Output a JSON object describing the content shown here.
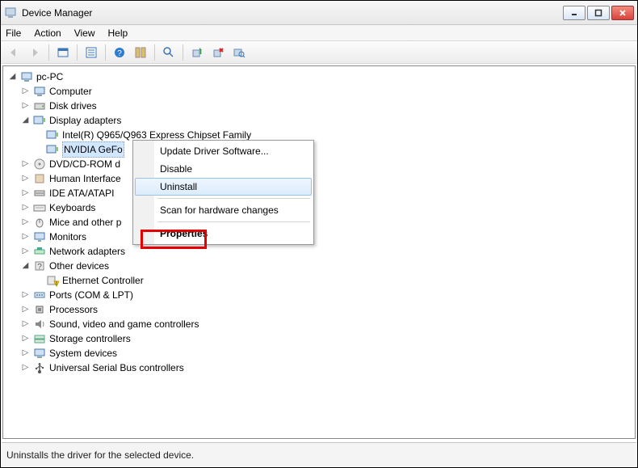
{
  "title": "Device Manager",
  "menu": {
    "file": "File",
    "action": "Action",
    "view": "View",
    "help": "Help"
  },
  "toolbar": {
    "back": "Back",
    "forward": "Forward",
    "show_hidden": "Show hidden",
    "properties": "Properties",
    "help": "Help",
    "options": "Options",
    "find": "Find",
    "update": "Update driver",
    "uninstall": "Uninstall",
    "scan": "Scan for hardware changes"
  },
  "tree": {
    "root": "pc-PC",
    "nodes": [
      {
        "label": "Computer",
        "icon": "computer"
      },
      {
        "label": "Disk drives",
        "icon": "disk"
      },
      {
        "label": "Display adapters",
        "icon": "display",
        "expanded": true,
        "children": [
          {
            "label": "Intel(R)  Q965/Q963 Express Chipset Family",
            "icon": "display"
          },
          {
            "label": "NVIDIA GeFo",
            "icon": "display",
            "selected": true
          }
        ]
      },
      {
        "label": "DVD/CD-ROM drives",
        "icon": "dvd",
        "truncated": "DVD/CD-ROM d"
      },
      {
        "label": "Human Interface Devices",
        "icon": "hid",
        "truncated": "Human Interface"
      },
      {
        "label": "IDE ATA/ATAPI controllers",
        "icon": "ide",
        "truncated": "IDE ATA/ATAPI"
      },
      {
        "label": "Keyboards",
        "icon": "keyboard"
      },
      {
        "label": "Mice and other pointing devices",
        "icon": "mouse",
        "truncated": "Mice and other p"
      },
      {
        "label": "Monitors",
        "icon": "monitor"
      },
      {
        "label": "Network adapters",
        "icon": "network"
      },
      {
        "label": "Other devices",
        "icon": "other",
        "expanded": true,
        "children": [
          {
            "label": "Ethernet Controller",
            "icon": "warning"
          }
        ]
      },
      {
        "label": "Ports (COM & LPT)",
        "icon": "ports"
      },
      {
        "label": "Processors",
        "icon": "cpu"
      },
      {
        "label": "Sound, video and game controllers",
        "icon": "sound"
      },
      {
        "label": "Storage controllers",
        "icon": "storage"
      },
      {
        "label": "System devices",
        "icon": "system"
      },
      {
        "label": "Universal Serial Bus controllers",
        "icon": "usb"
      }
    ]
  },
  "context_menu": {
    "update": "Update Driver Software...",
    "disable": "Disable",
    "uninstall": "Uninstall",
    "scan": "Scan for hardware changes",
    "properties": "Properties"
  },
  "status": "Uninstalls the driver for the selected device."
}
